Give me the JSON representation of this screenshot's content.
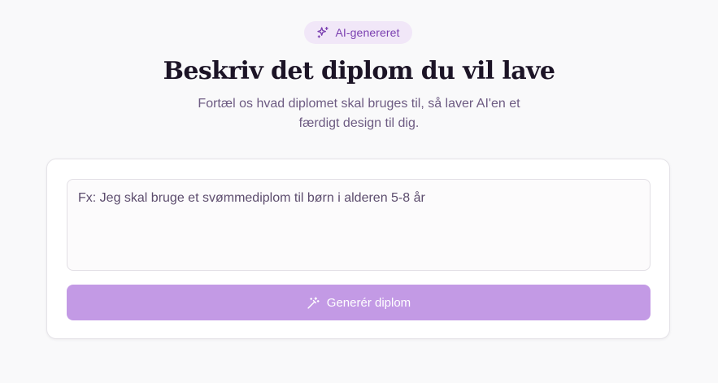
{
  "badge": {
    "icon": "sparkles-icon",
    "label": "AI-genereret",
    "color": "#7a3fb0",
    "background": "#f1e7f8"
  },
  "header": {
    "title": "Beskriv det diplom du vil lave",
    "subtitle": "Fortæl os hvad diplomet skal bruges til, så laver AI'en et færdigt design til dig."
  },
  "form": {
    "prompt_value": "",
    "prompt_placeholder": "Fx: Jeg skal bruge et svømmediplom til børn i alderen 5-8 år",
    "generate_icon": "magic-wand-icon",
    "generate_label": "Generér diplom",
    "button_color": "#c39ae5"
  }
}
